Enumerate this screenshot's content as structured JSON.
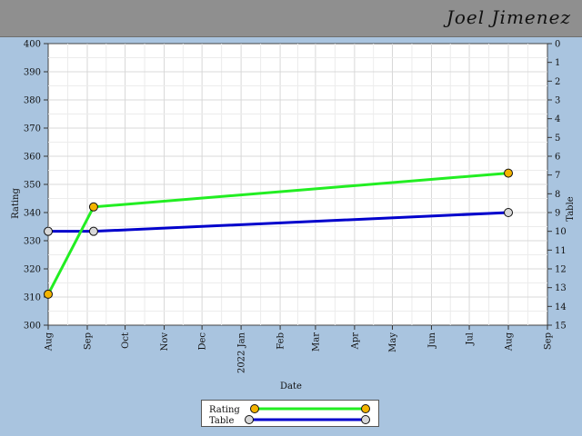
{
  "header": {
    "title": "Joel Jimenez"
  },
  "colors": {
    "rating": "#22ee22",
    "table": "#0000cc",
    "rating_marker": "#f4b400",
    "table_marker": "#d8d8d8"
  },
  "chart_data": {
    "type": "line",
    "title": "",
    "xlabel": "Date",
    "ylabel": "Rating",
    "y2label": "Table",
    "ylim": [
      300,
      400
    ],
    "y2lim": [
      0,
      15
    ],
    "y2_inverted": true,
    "y_ticks": [
      300,
      310,
      320,
      330,
      340,
      350,
      360,
      370,
      380,
      390,
      400
    ],
    "y2_ticks": [
      0,
      1,
      2,
      3,
      4,
      5,
      6,
      7,
      8,
      9,
      10,
      11,
      12,
      13,
      14,
      15
    ],
    "x_range": [
      "2021-08-01",
      "2022-09-01"
    ],
    "x_ticks": [
      "2021-08-01",
      "2021-09-01",
      "2021-10-01",
      "2021-11-01",
      "2021-12-01",
      "2022-01-01",
      "2022-02-01",
      "2022-03-01",
      "2022-04-01",
      "2022-05-01",
      "2022-06-01",
      "2022-07-01",
      "2022-08-01",
      "2022-09-01"
    ],
    "x_tick_labels": [
      "Aug",
      "Sep",
      "Oct",
      "Nov",
      "Dec",
      "2022 Jan",
      "Feb",
      "Mar",
      "Apr",
      "May",
      "Jun",
      "Jul",
      "Aug",
      "Sep"
    ],
    "grid": true,
    "legend": "bottom-center",
    "series": [
      {
        "name": "Rating",
        "axis": "left",
        "x": [
          "2021-08-01",
          "2021-09-06",
          "2022-08-01"
        ],
        "y": [
          311,
          342,
          354
        ]
      },
      {
        "name": "Table",
        "axis": "right",
        "x": [
          "2021-08-01",
          "2021-09-06",
          "2022-08-01"
        ],
        "y": [
          10,
          10,
          9
        ]
      }
    ]
  }
}
